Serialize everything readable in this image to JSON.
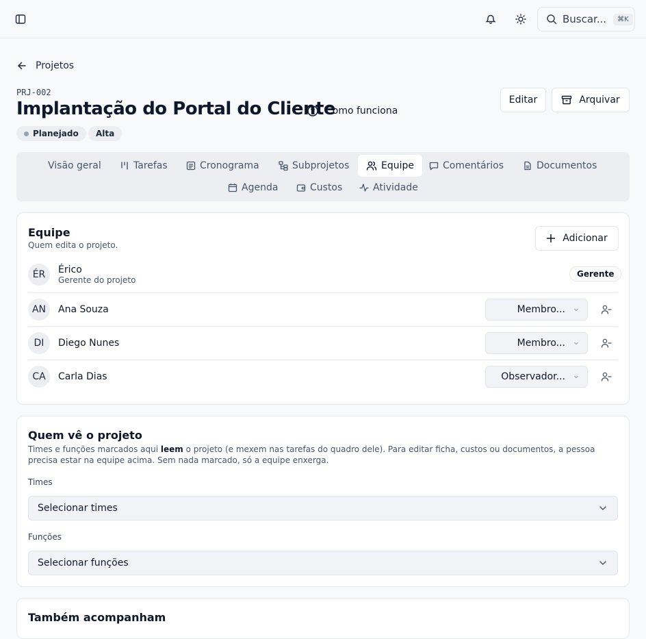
{
  "topbar": {
    "sidebar_icon": "sidebar-toggle-icon",
    "bell_icon": "bell-icon",
    "theme_icon": "sun-icon",
    "search_placeholder": "Buscar...",
    "search_shortcut": "⌘K"
  },
  "breadcrumb": {
    "back_label": "Projetos"
  },
  "project": {
    "code": "PRJ-002",
    "title": "Implantação do Portal do Cliente",
    "how_it_works": "Como funciona",
    "status": "Planejado",
    "priority": "Alta",
    "edit_label": "Editar",
    "archive_label": "Arquivar"
  },
  "tabs": [
    {
      "label": "Visão geral",
      "icon": "none"
    },
    {
      "label": "Tarefas",
      "icon": "kanban-icon"
    },
    {
      "label": "Cronograma",
      "icon": "list-icon"
    },
    {
      "label": "Subprojetos",
      "icon": "tree-icon"
    },
    {
      "label": "Equipe",
      "icon": "users-icon",
      "active": true
    },
    {
      "label": "Comentários",
      "icon": "message-icon"
    },
    {
      "label": "Documentos",
      "icon": "file-icon"
    },
    {
      "label": "Agenda",
      "icon": "calendar-icon"
    },
    {
      "label": "Custos",
      "icon": "wallet-icon"
    },
    {
      "label": "Atividade",
      "icon": "activity-icon"
    }
  ],
  "team": {
    "title": "Equipe",
    "subtitle": "Quem edita o projeto.",
    "add_label": "Adicionar",
    "manager": {
      "initials": "ÉR",
      "name": "Érico",
      "role": "Gerente do projeto",
      "badge": "Gerente"
    },
    "members": [
      {
        "initials": "AN",
        "name": "Ana Souza",
        "role": "Membro..."
      },
      {
        "initials": "DI",
        "name": "Diego Nunes",
        "role": "Membro..."
      },
      {
        "initials": "CA",
        "name": "Carla Dias",
        "role": "Observador..."
      }
    ]
  },
  "visibility": {
    "title": "Quem vê o projeto",
    "desc_before": "Times e funções marcados aqui ",
    "desc_bold": "leem",
    "desc_after": " o projeto (e mexem nas tarefas do quadro dele). Para editar ficha, custos ou documentos, a pessoa precisa estar na equipe acima. Sem nada marcado, só a equipe enxerga.",
    "teams_label": "Times",
    "teams_placeholder": "Selecionar times",
    "roles_label": "Funções",
    "roles_placeholder": "Selecionar funções"
  },
  "followers": {
    "title": "Também acompanham"
  }
}
